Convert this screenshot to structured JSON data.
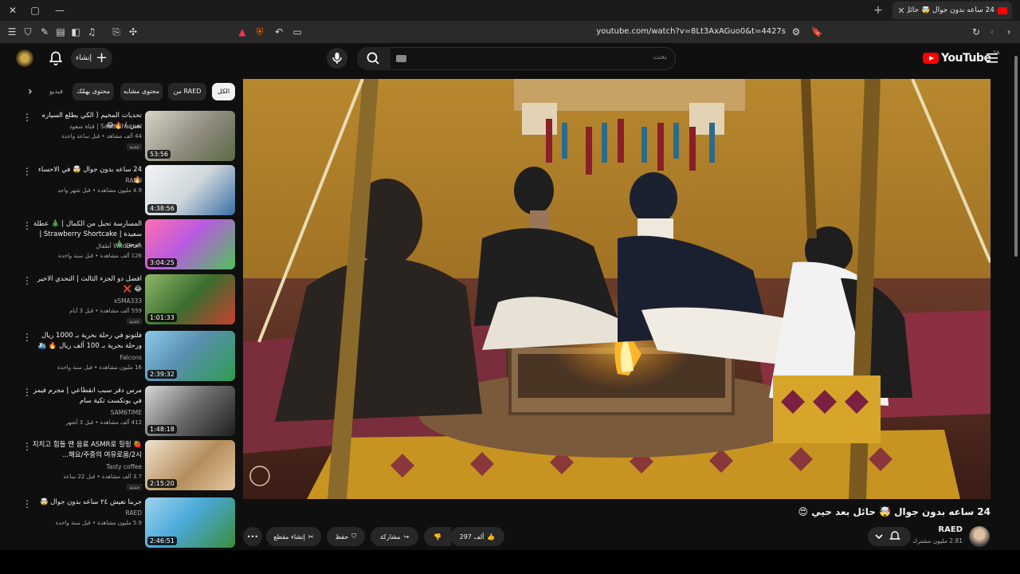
{
  "browser": {
    "tab_title": "24 ساعه بدون جوال 🤯 حائل بعد ح...",
    "url": "youtube.com/watch?v=8Lt3AxAGuo0&t=4427s",
    "new_tab": "+",
    "close_tab": "✕"
  },
  "header": {
    "create_label": "إنشاء",
    "search_placeholder": "بحث",
    "logo_text": "YouTube",
    "logo_country": "SA"
  },
  "chips": [
    {
      "label": "الكل",
      "active": true
    },
    {
      "label": "من RAED",
      "active": false
    },
    {
      "label": "محتوى مشابه",
      "active": false
    },
    {
      "label": "محتوى يهمّك",
      "active": false
    },
    {
      "label": "فيديو",
      "active": false
    }
  ],
  "recommendations": [
    {
      "title": "تحديات المخيم ( الكي يطلع السياره بعين ) 🔥😂",
      "channel": "Saud Channel | قناة سعود",
      "meta": "44 ألف مشاهد • قبل ساعة واحدة",
      "duration": "53:56",
      "badge": "جديد"
    },
    {
      "title": "24 ساعه بدون جوال 🤯 في الاحساء 🔥",
      "channel": "RAED",
      "meta": "4.9 مليون مشاهدة • قبل شهر واحد",
      "duration": "4:38:56",
      "badge": ""
    },
    {
      "title": "المسارسة تحبل من الكمال | 🎄 عطلة سعيدة | Strawberry Shortcake | عرض 🎄",
      "channel": "WildBrain أطفال",
      "meta": "126 ألف مشاهدة • قبل سنة واحدة",
      "duration": "3:04:25",
      "badge": ""
    },
    {
      "title": "افضل دو الجزء الثالث | التحدي الاخير 😂 ❌",
      "channel": "xSMA333",
      "meta": "559 ألف مشاهدة • قبل 3 أيام",
      "duration": "1:01:33",
      "badge": "جديد"
    },
    {
      "title": "فلتونو في رحلة بحرية بـ 1000 ريال ورحلة بحرية بـ 100 ألف ريال 🔥 🛳️",
      "channel": "Falcons",
      "meta": "16 مليون مشاهدة • قبل سنة واحدة",
      "duration": "2:39:32",
      "badge": ""
    },
    {
      "title": "مرس دقر سبب انقطاعي | مجرم فيمز في يونكست تكية سام",
      "channel": "SAM6TIME",
      "meta": "412 ألف مشاهدة • قبل 3 أشهر",
      "duration": "1:48:18",
      "badge": ""
    },
    {
      "title": "🍓 지치고 힘들 땐 음료 ASMR로 힐링해요/주중의 여유로움/2시...",
      "channel": "Tasty coffee",
      "meta": "3.7 ألف مشاهدة • قبل 22 ساعة",
      "duration": "2:15:20",
      "badge": "جديد"
    },
    {
      "title": "جربنا نعيش ٢٤ ساعه بدون جوال 🤯",
      "channel": "RAED",
      "meta": "5.9 مليون مشاهدة • قبل سنة واحدة",
      "duration": "2:46:51",
      "badge": ""
    }
  ],
  "video": {
    "title": "24 ساعه بدون جوال 🤯 حائل بعد حيي 😍",
    "channel": "RAED",
    "subscribers": "2.81 مليون مشترك",
    "likes": "297 ألف",
    "share_label": "مشاركة",
    "save_label": "حفظ",
    "clip_label": "إنشاء مقطع",
    "more_label": "•••"
  },
  "colors": {
    "accent": "#ff0000",
    "bg": "#0f0f0f",
    "chip": "#272727"
  }
}
